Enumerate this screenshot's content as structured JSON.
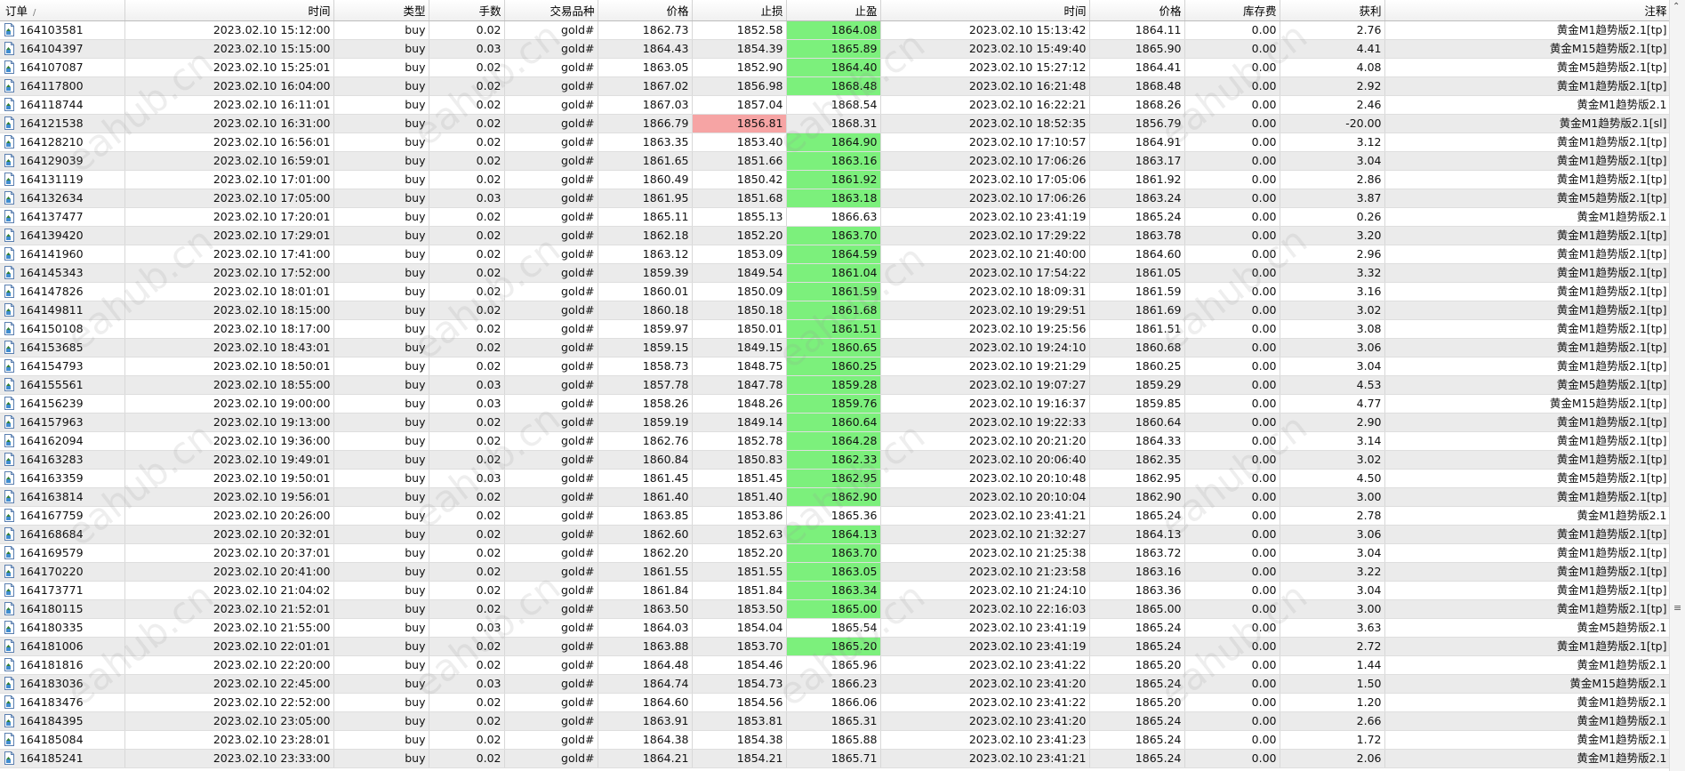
{
  "columns": [
    "订单",
    "时间",
    "类型",
    "手数",
    "交易品种",
    "价格",
    "止损",
    "止盈",
    "时间",
    "价格",
    "库存费",
    "获利",
    "注释"
  ],
  "sort_indicator": "/",
  "watermark_text": "eahub.cn",
  "colors": {
    "tp_highlight": "#7cf07c",
    "sl_highlight": "#f6a4a4",
    "row_alt": "#ebebeb"
  },
  "icons": {
    "order": "document-icon",
    "scroll_up": "scroll-up-arrow-icon"
  },
  "rows": [
    {
      "order": "164103581",
      "open_time": "2023.02.10 15:12:00",
      "type": "buy",
      "lots": "0.02",
      "symbol": "gold#",
      "open_price": "1862.73",
      "sl": "1852.58",
      "tp": "1864.08",
      "close_time": "2023.02.10 15:13:42",
      "close_price": "1864.11",
      "swap": "0.00",
      "profit": "2.76",
      "comment": "黄金M1趋势版2.1[tp]",
      "hl": "tp"
    },
    {
      "order": "164104397",
      "open_time": "2023.02.10 15:15:00",
      "type": "buy",
      "lots": "0.03",
      "symbol": "gold#",
      "open_price": "1864.43",
      "sl": "1854.39",
      "tp": "1865.89",
      "close_time": "2023.02.10 15:49:40",
      "close_price": "1865.90",
      "swap": "0.00",
      "profit": "4.41",
      "comment": "黄金M15趋势版2.1[tp]",
      "hl": "tp"
    },
    {
      "order": "164107087",
      "open_time": "2023.02.10 15:25:01",
      "type": "buy",
      "lots": "0.02",
      "symbol": "gold#",
      "open_price": "1863.05",
      "sl": "1852.90",
      "tp": "1864.40",
      "close_time": "2023.02.10 15:27:12",
      "close_price": "1864.41",
      "swap": "0.00",
      "profit": "4.08",
      "comment": "黄金M5趋势版2.1[tp]",
      "hl": "tp"
    },
    {
      "order": "164117800",
      "open_time": "2023.02.10 16:04:00",
      "type": "buy",
      "lots": "0.02",
      "symbol": "gold#",
      "open_price": "1867.02",
      "sl": "1856.98",
      "tp": "1868.48",
      "close_time": "2023.02.10 16:21:48",
      "close_price": "1868.48",
      "swap": "0.00",
      "profit": "2.92",
      "comment": "黄金M1趋势版2.1[tp]",
      "hl": "tp"
    },
    {
      "order": "164118744",
      "open_time": "2023.02.10 16:11:01",
      "type": "buy",
      "lots": "0.02",
      "symbol": "gold#",
      "open_price": "1867.03",
      "sl": "1857.04",
      "tp": "1868.54",
      "close_time": "2023.02.10 16:22:21",
      "close_price": "1868.26",
      "swap": "0.00",
      "profit": "2.46",
      "comment": "黄金M1趋势版2.1",
      "hl": ""
    },
    {
      "order": "164121538",
      "open_time": "2023.02.10 16:31:00",
      "type": "buy",
      "lots": "0.02",
      "symbol": "gold#",
      "open_price": "1866.79",
      "sl": "1856.81",
      "tp": "1868.31",
      "close_time": "2023.02.10 18:52:35",
      "close_price": "1856.79",
      "swap": "0.00",
      "profit": "-20.00",
      "comment": "黄金M1趋势版2.1[sl]",
      "hl": "sl"
    },
    {
      "order": "164128210",
      "open_time": "2023.02.10 16:56:01",
      "type": "buy",
      "lots": "0.02",
      "symbol": "gold#",
      "open_price": "1863.35",
      "sl": "1853.40",
      "tp": "1864.90",
      "close_time": "2023.02.10 17:10:57",
      "close_price": "1864.91",
      "swap": "0.00",
      "profit": "3.12",
      "comment": "黄金M1趋势版2.1[tp]",
      "hl": "tp"
    },
    {
      "order": "164129039",
      "open_time": "2023.02.10 16:59:01",
      "type": "buy",
      "lots": "0.02",
      "symbol": "gold#",
      "open_price": "1861.65",
      "sl": "1851.66",
      "tp": "1863.16",
      "close_time": "2023.02.10 17:06:26",
      "close_price": "1863.17",
      "swap": "0.00",
      "profit": "3.04",
      "comment": "黄金M1趋势版2.1[tp]",
      "hl": "tp"
    },
    {
      "order": "164131119",
      "open_time": "2023.02.10 17:01:00",
      "type": "buy",
      "lots": "0.02",
      "symbol": "gold#",
      "open_price": "1860.49",
      "sl": "1850.42",
      "tp": "1861.92",
      "close_time": "2023.02.10 17:05:06",
      "close_price": "1861.92",
      "swap": "0.00",
      "profit": "2.86",
      "comment": "黄金M1趋势版2.1[tp]",
      "hl": "tp"
    },
    {
      "order": "164132634",
      "open_time": "2023.02.10 17:05:00",
      "type": "buy",
      "lots": "0.03",
      "symbol": "gold#",
      "open_price": "1861.95",
      "sl": "1851.68",
      "tp": "1863.18",
      "close_time": "2023.02.10 17:06:26",
      "close_price": "1863.24",
      "swap": "0.00",
      "profit": "3.87",
      "comment": "黄金M5趋势版2.1[tp]",
      "hl": "tp"
    },
    {
      "order": "164137477",
      "open_time": "2023.02.10 17:20:01",
      "type": "buy",
      "lots": "0.02",
      "symbol": "gold#",
      "open_price": "1865.11",
      "sl": "1855.13",
      "tp": "1866.63",
      "close_time": "2023.02.10 23:41:19",
      "close_price": "1865.24",
      "swap": "0.00",
      "profit": "0.26",
      "comment": "黄金M1趋势版2.1",
      "hl": ""
    },
    {
      "order": "164139420",
      "open_time": "2023.02.10 17:29:01",
      "type": "buy",
      "lots": "0.02",
      "symbol": "gold#",
      "open_price": "1862.18",
      "sl": "1852.20",
      "tp": "1863.70",
      "close_time": "2023.02.10 17:29:22",
      "close_price": "1863.78",
      "swap": "0.00",
      "profit": "3.20",
      "comment": "黄金M1趋势版2.1[tp]",
      "hl": "tp"
    },
    {
      "order": "164141960",
      "open_time": "2023.02.10 17:41:00",
      "type": "buy",
      "lots": "0.02",
      "symbol": "gold#",
      "open_price": "1863.12",
      "sl": "1853.09",
      "tp": "1864.59",
      "close_time": "2023.02.10 21:40:00",
      "close_price": "1864.60",
      "swap": "0.00",
      "profit": "2.96",
      "comment": "黄金M1趋势版2.1[tp]",
      "hl": "tp"
    },
    {
      "order": "164145343",
      "open_time": "2023.02.10 17:52:00",
      "type": "buy",
      "lots": "0.02",
      "symbol": "gold#",
      "open_price": "1859.39",
      "sl": "1849.54",
      "tp": "1861.04",
      "close_time": "2023.02.10 17:54:22",
      "close_price": "1861.05",
      "swap": "0.00",
      "profit": "3.32",
      "comment": "黄金M1趋势版2.1[tp]",
      "hl": "tp"
    },
    {
      "order": "164147826",
      "open_time": "2023.02.10 18:01:01",
      "type": "buy",
      "lots": "0.02",
      "symbol": "gold#",
      "open_price": "1860.01",
      "sl": "1850.09",
      "tp": "1861.59",
      "close_time": "2023.02.10 18:09:31",
      "close_price": "1861.59",
      "swap": "0.00",
      "profit": "3.16",
      "comment": "黄金M1趋势版2.1[tp]",
      "hl": "tp"
    },
    {
      "order": "164149811",
      "open_time": "2023.02.10 18:15:00",
      "type": "buy",
      "lots": "0.02",
      "symbol": "gold#",
      "open_price": "1860.18",
      "sl": "1850.18",
      "tp": "1861.68",
      "close_time": "2023.02.10 19:29:51",
      "close_price": "1861.69",
      "swap": "0.00",
      "profit": "3.02",
      "comment": "黄金M1趋势版2.1[tp]",
      "hl": "tp"
    },
    {
      "order": "164150108",
      "open_time": "2023.02.10 18:17:00",
      "type": "buy",
      "lots": "0.02",
      "symbol": "gold#",
      "open_price": "1859.97",
      "sl": "1850.01",
      "tp": "1861.51",
      "close_time": "2023.02.10 19:25:56",
      "close_price": "1861.51",
      "swap": "0.00",
      "profit": "3.08",
      "comment": "黄金M1趋势版2.1[tp]",
      "hl": "tp"
    },
    {
      "order": "164153685",
      "open_time": "2023.02.10 18:43:01",
      "type": "buy",
      "lots": "0.02",
      "symbol": "gold#",
      "open_price": "1859.15",
      "sl": "1849.15",
      "tp": "1860.65",
      "close_time": "2023.02.10 19:24:10",
      "close_price": "1860.68",
      "swap": "0.00",
      "profit": "3.06",
      "comment": "黄金M1趋势版2.1[tp]",
      "hl": "tp"
    },
    {
      "order": "164154793",
      "open_time": "2023.02.10 18:50:01",
      "type": "buy",
      "lots": "0.02",
      "symbol": "gold#",
      "open_price": "1858.73",
      "sl": "1848.75",
      "tp": "1860.25",
      "close_time": "2023.02.10 19:21:29",
      "close_price": "1860.25",
      "swap": "0.00",
      "profit": "3.04",
      "comment": "黄金M1趋势版2.1[tp]",
      "hl": "tp"
    },
    {
      "order": "164155561",
      "open_time": "2023.02.10 18:55:00",
      "type": "buy",
      "lots": "0.03",
      "symbol": "gold#",
      "open_price": "1857.78",
      "sl": "1847.78",
      "tp": "1859.28",
      "close_time": "2023.02.10 19:07:27",
      "close_price": "1859.29",
      "swap": "0.00",
      "profit": "4.53",
      "comment": "黄金M5趋势版2.1[tp]",
      "hl": "tp"
    },
    {
      "order": "164156239",
      "open_time": "2023.02.10 19:00:00",
      "type": "buy",
      "lots": "0.03",
      "symbol": "gold#",
      "open_price": "1858.26",
      "sl": "1848.26",
      "tp": "1859.76",
      "close_time": "2023.02.10 19:16:37",
      "close_price": "1859.85",
      "swap": "0.00",
      "profit": "4.77",
      "comment": "黄金M15趋势版2.1[tp]",
      "hl": "tp"
    },
    {
      "order": "164157963",
      "open_time": "2023.02.10 19:13:00",
      "type": "buy",
      "lots": "0.02",
      "symbol": "gold#",
      "open_price": "1859.19",
      "sl": "1849.14",
      "tp": "1860.64",
      "close_time": "2023.02.10 19:22:33",
      "close_price": "1860.64",
      "swap": "0.00",
      "profit": "2.90",
      "comment": "黄金M1趋势版2.1[tp]",
      "hl": "tp"
    },
    {
      "order": "164162094",
      "open_time": "2023.02.10 19:36:00",
      "type": "buy",
      "lots": "0.02",
      "symbol": "gold#",
      "open_price": "1862.76",
      "sl": "1852.78",
      "tp": "1864.28",
      "close_time": "2023.02.10 20:21:20",
      "close_price": "1864.33",
      "swap": "0.00",
      "profit": "3.14",
      "comment": "黄金M1趋势版2.1[tp]",
      "hl": "tp"
    },
    {
      "order": "164163283",
      "open_time": "2023.02.10 19:49:01",
      "type": "buy",
      "lots": "0.02",
      "symbol": "gold#",
      "open_price": "1860.84",
      "sl": "1850.83",
      "tp": "1862.33",
      "close_time": "2023.02.10 20:06:40",
      "close_price": "1862.35",
      "swap": "0.00",
      "profit": "3.02",
      "comment": "黄金M1趋势版2.1[tp]",
      "hl": "tp"
    },
    {
      "order": "164163359",
      "open_time": "2023.02.10 19:50:01",
      "type": "buy",
      "lots": "0.03",
      "symbol": "gold#",
      "open_price": "1861.45",
      "sl": "1851.45",
      "tp": "1862.95",
      "close_time": "2023.02.10 20:10:48",
      "close_price": "1862.95",
      "swap": "0.00",
      "profit": "4.50",
      "comment": "黄金M5趋势版2.1[tp]",
      "hl": "tp"
    },
    {
      "order": "164163814",
      "open_time": "2023.02.10 19:56:01",
      "type": "buy",
      "lots": "0.02",
      "symbol": "gold#",
      "open_price": "1861.40",
      "sl": "1851.40",
      "tp": "1862.90",
      "close_time": "2023.02.10 20:10:04",
      "close_price": "1862.90",
      "swap": "0.00",
      "profit": "3.00",
      "comment": "黄金M1趋势版2.1[tp]",
      "hl": "tp"
    },
    {
      "order": "164167759",
      "open_time": "2023.02.10 20:26:00",
      "type": "buy",
      "lots": "0.02",
      "symbol": "gold#",
      "open_price": "1863.85",
      "sl": "1853.86",
      "tp": "1865.36",
      "close_time": "2023.02.10 23:41:21",
      "close_price": "1865.24",
      "swap": "0.00",
      "profit": "2.78",
      "comment": "黄金M1趋势版2.1",
      "hl": ""
    },
    {
      "order": "164168684",
      "open_time": "2023.02.10 20:32:01",
      "type": "buy",
      "lots": "0.02",
      "symbol": "gold#",
      "open_price": "1862.60",
      "sl": "1852.63",
      "tp": "1864.13",
      "close_time": "2023.02.10 21:32:27",
      "close_price": "1864.13",
      "swap": "0.00",
      "profit": "3.06",
      "comment": "黄金M1趋势版2.1[tp]",
      "hl": "tp"
    },
    {
      "order": "164169579",
      "open_time": "2023.02.10 20:37:01",
      "type": "buy",
      "lots": "0.02",
      "symbol": "gold#",
      "open_price": "1862.20",
      "sl": "1852.20",
      "tp": "1863.70",
      "close_time": "2023.02.10 21:25:38",
      "close_price": "1863.72",
      "swap": "0.00",
      "profit": "3.04",
      "comment": "黄金M1趋势版2.1[tp]",
      "hl": "tp"
    },
    {
      "order": "164170220",
      "open_time": "2023.02.10 20:41:00",
      "type": "buy",
      "lots": "0.02",
      "symbol": "gold#",
      "open_price": "1861.55",
      "sl": "1851.55",
      "tp": "1863.05",
      "close_time": "2023.02.10 21:23:58",
      "close_price": "1863.16",
      "swap": "0.00",
      "profit": "3.22",
      "comment": "黄金M1趋势版2.1[tp]",
      "hl": "tp"
    },
    {
      "order": "164173771",
      "open_time": "2023.02.10 21:04:02",
      "type": "buy",
      "lots": "0.02",
      "symbol": "gold#",
      "open_price": "1861.84",
      "sl": "1851.84",
      "tp": "1863.34",
      "close_time": "2023.02.10 21:24:10",
      "close_price": "1863.36",
      "swap": "0.00",
      "profit": "3.04",
      "comment": "黄金M1趋势版2.1[tp]",
      "hl": "tp"
    },
    {
      "order": "164180115",
      "open_time": "2023.02.10 21:52:01",
      "type": "buy",
      "lots": "0.02",
      "symbol": "gold#",
      "open_price": "1863.50",
      "sl": "1853.50",
      "tp": "1865.00",
      "close_time": "2023.02.10 22:16:03",
      "close_price": "1865.00",
      "swap": "0.00",
      "profit": "3.00",
      "comment": "黄金M1趋势版2.1[tp]",
      "hl": "tp"
    },
    {
      "order": "164180335",
      "open_time": "2023.02.10 21:55:00",
      "type": "buy",
      "lots": "0.03",
      "symbol": "gold#",
      "open_price": "1864.03",
      "sl": "1854.04",
      "tp": "1865.54",
      "close_time": "2023.02.10 23:41:19",
      "close_price": "1865.24",
      "swap": "0.00",
      "profit": "3.63",
      "comment": "黄金M5趋势版2.1",
      "hl": ""
    },
    {
      "order": "164181006",
      "open_time": "2023.02.10 22:01:01",
      "type": "buy",
      "lots": "0.02",
      "symbol": "gold#",
      "open_price": "1863.88",
      "sl": "1853.70",
      "tp": "1865.20",
      "close_time": "2023.02.10 23:41:19",
      "close_price": "1865.24",
      "swap": "0.00",
      "profit": "2.72",
      "comment": "黄金M1趋势版2.1[tp]",
      "hl": "tp"
    },
    {
      "order": "164181816",
      "open_time": "2023.02.10 22:20:00",
      "type": "buy",
      "lots": "0.02",
      "symbol": "gold#",
      "open_price": "1864.48",
      "sl": "1854.46",
      "tp": "1865.96",
      "close_time": "2023.02.10 23:41:22",
      "close_price": "1865.20",
      "swap": "0.00",
      "profit": "1.44",
      "comment": "黄金M1趋势版2.1",
      "hl": ""
    },
    {
      "order": "164183036",
      "open_time": "2023.02.10 22:45:00",
      "type": "buy",
      "lots": "0.03",
      "symbol": "gold#",
      "open_price": "1864.74",
      "sl": "1854.73",
      "tp": "1866.23",
      "close_time": "2023.02.10 23:41:20",
      "close_price": "1865.24",
      "swap": "0.00",
      "profit": "1.50",
      "comment": "黄金M15趋势版2.1",
      "hl": ""
    },
    {
      "order": "164183476",
      "open_time": "2023.02.10 22:52:00",
      "type": "buy",
      "lots": "0.02",
      "symbol": "gold#",
      "open_price": "1864.60",
      "sl": "1854.56",
      "tp": "1866.06",
      "close_time": "2023.02.10 23:41:22",
      "close_price": "1865.20",
      "swap": "0.00",
      "profit": "1.20",
      "comment": "黄金M1趋势版2.1",
      "hl": ""
    },
    {
      "order": "164184395",
      "open_time": "2023.02.10 23:05:00",
      "type": "buy",
      "lots": "0.02",
      "symbol": "gold#",
      "open_price": "1863.91",
      "sl": "1853.81",
      "tp": "1865.31",
      "close_time": "2023.02.10 23:41:20",
      "close_price": "1865.24",
      "swap": "0.00",
      "profit": "2.66",
      "comment": "黄金M1趋势版2.1",
      "hl": ""
    },
    {
      "order": "164185084",
      "open_time": "2023.02.10 23:28:01",
      "type": "buy",
      "lots": "0.02",
      "symbol": "gold#",
      "open_price": "1864.38",
      "sl": "1854.38",
      "tp": "1865.88",
      "close_time": "2023.02.10 23:41:23",
      "close_price": "1865.24",
      "swap": "0.00",
      "profit": "1.72",
      "comment": "黄金M1趋势版2.1",
      "hl": ""
    },
    {
      "order": "164185241",
      "open_time": "2023.02.10 23:33:00",
      "type": "buy",
      "lots": "0.02",
      "symbol": "gold#",
      "open_price": "1864.21",
      "sl": "1854.21",
      "tp": "1865.71",
      "close_time": "2023.02.10 23:41:21",
      "close_price": "1865.24",
      "swap": "0.00",
      "profit": "2.06",
      "comment": "黄金M1趋势版2.1",
      "hl": ""
    }
  ]
}
